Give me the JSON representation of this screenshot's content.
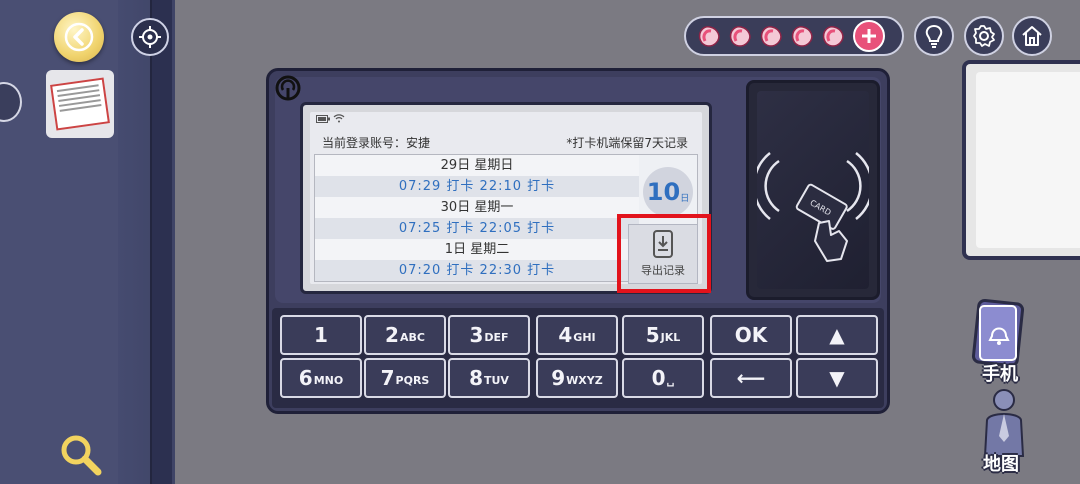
{
  "header": {
    "account_label": "当前登录账号：安捷",
    "retention_note": "*打卡机端保留7天记录"
  },
  "records": [
    {
      "day": "29日  星期日",
      "times": "07:29 打卡    22:10 打卡"
    },
    {
      "day": "30日  星期一",
      "times": "07:25 打卡    22:05 打卡"
    },
    {
      "day": "1日  星期二",
      "times": "07:20 打卡    22:30 打卡"
    }
  ],
  "day_badge": {
    "number": "10",
    "unit": "日"
  },
  "export": {
    "label": "导出记录"
  },
  "keypad": {
    "row1": [
      {
        "big": "1",
        "small": ""
      },
      {
        "big": "2",
        "small": "ABC"
      },
      {
        "big": "3",
        "small": "DEF"
      },
      {
        "big": "4",
        "small": "GHI"
      },
      {
        "big": "5",
        "small": "JKL"
      },
      {
        "big": "OK",
        "small": ""
      },
      {
        "big": "▲",
        "small": ""
      }
    ],
    "row2": [
      {
        "big": "6",
        "small": "MNO"
      },
      {
        "big": "7",
        "small": "PQRS"
      },
      {
        "big": "8",
        "small": "TUV"
      },
      {
        "big": "9",
        "small": "WXYZ"
      },
      {
        "big": "0",
        "small": "␣"
      },
      {
        "big": "⟵",
        "small": ""
      },
      {
        "big": "▼",
        "small": ""
      }
    ]
  },
  "inventory": {
    "phone_label": "手机",
    "map_label": "地图"
  },
  "card_text": "CARD",
  "hearts": {
    "count": 5
  },
  "colors": {
    "accent_blue": "#2f6fbf",
    "highlight_red": "#e2131c",
    "bean_pink": "#e8517a",
    "back_gold": "#f0d36d"
  }
}
